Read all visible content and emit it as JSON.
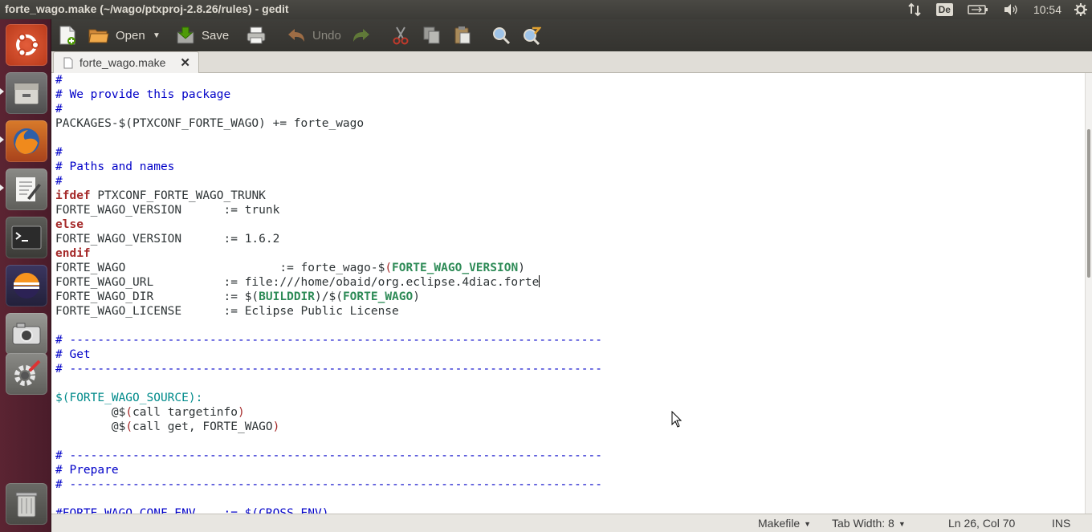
{
  "window": {
    "title": "forte_wago.make (~/wago/ptxproj-2.8.26/rules) - gedit"
  },
  "panel": {
    "keyboard_layout": "De",
    "clock": "10:54"
  },
  "launcher": {
    "items": [
      "Ubuntu Dash",
      "Files",
      "Firefox",
      "Text Editor",
      "Terminal",
      "Eclipse",
      "Screenshot",
      "System Settings",
      "Trash"
    ]
  },
  "toolbar": {
    "new_label": "",
    "open_label": "Open",
    "save_label": "Save",
    "undo_label": "Undo"
  },
  "tab": {
    "label": "forte_wago.make",
    "close": "✕"
  },
  "editor": {
    "lines": [
      [
        {
          "t": "#",
          "c": "comment"
        }
      ],
      [
        {
          "t": "# We provide this package",
          "c": "comment"
        }
      ],
      [
        {
          "t": "#",
          "c": "comment"
        }
      ],
      [
        {
          "t": "PACKAGES-$(PTXCONF_FORTE_WAGO) += forte_wago",
          "c": ""
        }
      ],
      [
        {
          "t": "",
          "c": ""
        }
      ],
      [
        {
          "t": "#",
          "c": "comment"
        }
      ],
      [
        {
          "t": "# Paths and names",
          "c": "comment"
        }
      ],
      [
        {
          "t": "#",
          "c": "comment"
        }
      ],
      [
        {
          "t": "ifdef",
          "c": "kw"
        },
        {
          "t": " PTXCONF_FORTE_WAGO_TRUNK",
          "c": ""
        }
      ],
      [
        {
          "t": "FORTE_WAGO_VERSION      := trunk",
          "c": ""
        }
      ],
      [
        {
          "t": "else",
          "c": "kw"
        }
      ],
      [
        {
          "t": "FORTE_WAGO_VERSION      := 1.6.2",
          "c": ""
        }
      ],
      [
        {
          "t": "endif",
          "c": "kw"
        }
      ],
      [
        {
          "t": "FORTE_WAGO                      := forte_wago-$",
          "c": ""
        },
        {
          "t": "(",
          "c": "paren"
        },
        {
          "t": "FORTE_WAGO_VERSION",
          "c": "ident"
        },
        {
          "t": ")",
          "c": ""
        }
      ],
      [
        {
          "t": "FORTE_WAGO_URL          := file:///home/obaid/org.eclipse.4diac.forte",
          "c": ""
        },
        {
          "cursor": true
        }
      ],
      [
        {
          "t": "FORTE_WAGO_DIR          := $(",
          "c": ""
        },
        {
          "t": "BUILDDIR",
          "c": "ident"
        },
        {
          "t": ")/$(",
          "c": ""
        },
        {
          "t": "FORTE_WAGO",
          "c": "ident"
        },
        {
          "t": ")",
          "c": ""
        }
      ],
      [
        {
          "t": "FORTE_WAGO_LICENSE      := Eclipse Public License",
          "c": ""
        }
      ],
      [
        {
          "t": "",
          "c": ""
        }
      ],
      [
        {
          "t": "# ----------------------------------------------------------------------------",
          "c": "comment"
        }
      ],
      [
        {
          "t": "# Get",
          "c": "comment"
        }
      ],
      [
        {
          "t": "# ----------------------------------------------------------------------------",
          "c": "comment"
        }
      ],
      [
        {
          "t": "",
          "c": ""
        }
      ],
      [
        {
          "t": "$(FORTE_WAGO_SOURCE):",
          "c": "var"
        }
      ],
      [
        {
          "t": "        @$",
          "c": ""
        },
        {
          "t": "(",
          "c": "paren"
        },
        {
          "t": "call targetinfo",
          "c": ""
        },
        {
          "t": ")",
          "c": "paren"
        }
      ],
      [
        {
          "t": "        @$",
          "c": ""
        },
        {
          "t": "(",
          "c": "paren"
        },
        {
          "t": "call get, FORTE_WAGO",
          "c": ""
        },
        {
          "t": ")",
          "c": "paren"
        }
      ],
      [
        {
          "t": "",
          "c": ""
        }
      ],
      [
        {
          "t": "# ----------------------------------------------------------------------------",
          "c": "comment"
        }
      ],
      [
        {
          "t": "# Prepare",
          "c": "comment"
        }
      ],
      [
        {
          "t": "# ----------------------------------------------------------------------------",
          "c": "comment"
        }
      ],
      [
        {
          "t": "",
          "c": ""
        }
      ],
      [
        {
          "t": "#FORTE_WAGO_CONF_ENV    := $(CROSS_ENV)",
          "c": "comment"
        }
      ]
    ]
  },
  "status": {
    "language": "Makefile",
    "tab_width": "Tab Width: 8",
    "position": "Ln 26, Col 70",
    "mode": "INS"
  }
}
